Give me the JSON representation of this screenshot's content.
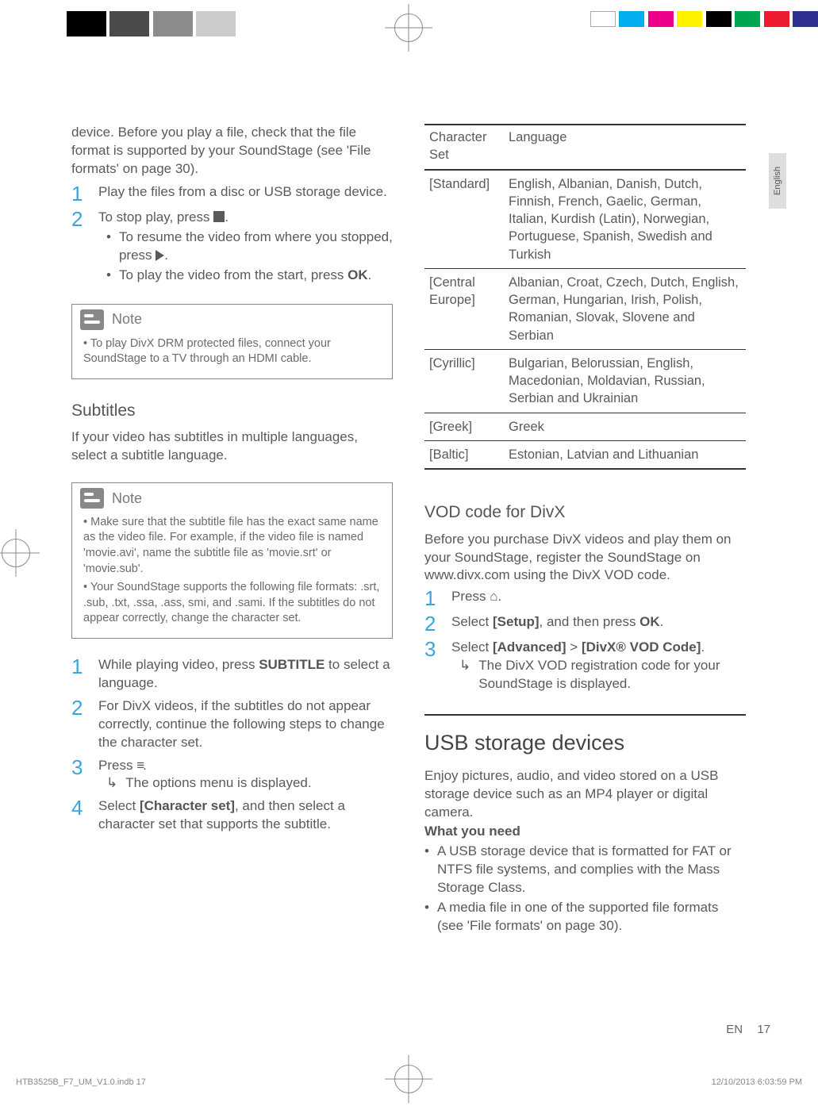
{
  "lang_tab": "English",
  "left": {
    "intro": "device. Before you play a file, check that the file format is supported by your SoundStage (see 'File formats' on page 30).",
    "steps_a": [
      "Play the files from a disc or USB storage device.",
      "To stop play, press "
    ],
    "step2_bullet1_a": "To resume the video from where you stopped, press ",
    "step2_bullet1_b": ".",
    "step2_bullet2_a": "To play the video from the start, press ",
    "step2_bullet2_b": "OK",
    "step2_bullet2_c": ".",
    "note1_title": "Note",
    "note1_item": "To play DivX DRM protected files, connect your SoundStage to a TV through an HDMI cable.",
    "subtitles_h": "Subtitles",
    "subtitles_p": "If your video has subtitles in multiple languages, select a subtitle language.",
    "note2_title": "Note",
    "note2_item1": "Make sure that the subtitle file has the exact same name as the video file. For example, if the video file is named 'movie.avi', name the subtitle file as 'movie.srt' or 'movie.sub'.",
    "note2_item2": "Your SoundStage supports the following file formats: .srt, .sub, .txt, .ssa, .ass, smi, and .sami. If the subtitles do not appear correctly, change the character set.",
    "steps_b_1a": "While playing video, press ",
    "steps_b_1b": "SUBTITLE",
    "steps_b_1c": " to select a language.",
    "steps_b_2": "For DivX videos, if the subtitles do not appear correctly, continue the following steps to change the character set.",
    "steps_b_3a": "Press ",
    "steps_b_3b": ".",
    "steps_b_3_sub": "The options menu is displayed.",
    "steps_b_4a": "Select ",
    "steps_b_4b": "[Character set]",
    "steps_b_4c": ", and then select a character set that supports the subtitle."
  },
  "right": {
    "table_head_1": "Character Set",
    "table_head_2": "Language",
    "rows": [
      {
        "set": "[Standard]",
        "lang": "English, Albanian, Danish, Dutch, Finnish, French, Gaelic, German, Italian, Kurdish (Latin), Norwegian, Portuguese, Spanish, Swedish and Turkish"
      },
      {
        "set": "[Central Europe]",
        "lang": "Albanian, Croat, Czech, Dutch, English, German, Hungarian, Irish, Polish, Romanian, Slovak, Slovene and Serbian"
      },
      {
        "set": "[Cyrillic]",
        "lang": "Bulgarian, Belorussian, English, Macedonian, Moldavian, Russian, Serbian and Ukrainian"
      },
      {
        "set": "[Greek]",
        "lang": "Greek"
      },
      {
        "set": "[Baltic]",
        "lang": "Estonian, Latvian and Lithuanian"
      }
    ],
    "vod_h": "VOD code for DivX",
    "vod_p": "Before you purchase DivX videos and play them on your SoundStage, register the SoundStage on www.divx.com using the DivX VOD code.",
    "vod_s1a": "Press ",
    "vod_s1b": ".",
    "vod_s2a": "Select ",
    "vod_s2b": "[Setup]",
    "vod_s2c": ", and then press ",
    "vod_s2d": "OK",
    "vod_s2e": ".",
    "vod_s3a": "Select ",
    "vod_s3b": "[Advanced]",
    "vod_s3c": " > ",
    "vod_s3d": "[DivX® VOD Code]",
    "vod_s3e": ".",
    "vod_s3_sub": "The DivX VOD registration code for your SoundStage is displayed.",
    "usb_h": "USB storage devices",
    "usb_p": "Enjoy pictures, audio, and video stored on a USB storage device such as an MP4 player or digital camera.",
    "usb_need_h": "What you need",
    "usb_need_1": "A USB storage device that is formatted for FAT or NTFS file systems, and complies with the Mass Storage Class.",
    "usb_need_2": "A media file in one of the supported file formats (see 'File formats' on page 30)."
  },
  "footer": {
    "lang_code": "EN",
    "page_no": "17",
    "indb": "HTB3525B_F7_UM_V1.0.indb   17",
    "timestamp": "12/10/2013   6:03:59 PM"
  },
  "chart_data": {
    "type": "table",
    "title": "Character Set / Language",
    "columns": [
      "Character Set",
      "Language"
    ],
    "rows": [
      [
        "[Standard]",
        "English, Albanian, Danish, Dutch, Finnish, French, Gaelic, German, Italian, Kurdish (Latin), Norwegian, Portuguese, Spanish, Swedish and Turkish"
      ],
      [
        "[Central Europe]",
        "Albanian, Croat, Czech, Dutch, English, German, Hungarian, Irish, Polish, Romanian, Slovak, Slovene and Serbian"
      ],
      [
        "[Cyrillic]",
        "Bulgarian, Belorussian, English, Macedonian, Moldavian, Russian, Serbian and Ukrainian"
      ],
      [
        "[Greek]",
        "Greek"
      ],
      [
        "[Baltic]",
        "Estonian, Latvian and Lithuanian"
      ]
    ]
  }
}
